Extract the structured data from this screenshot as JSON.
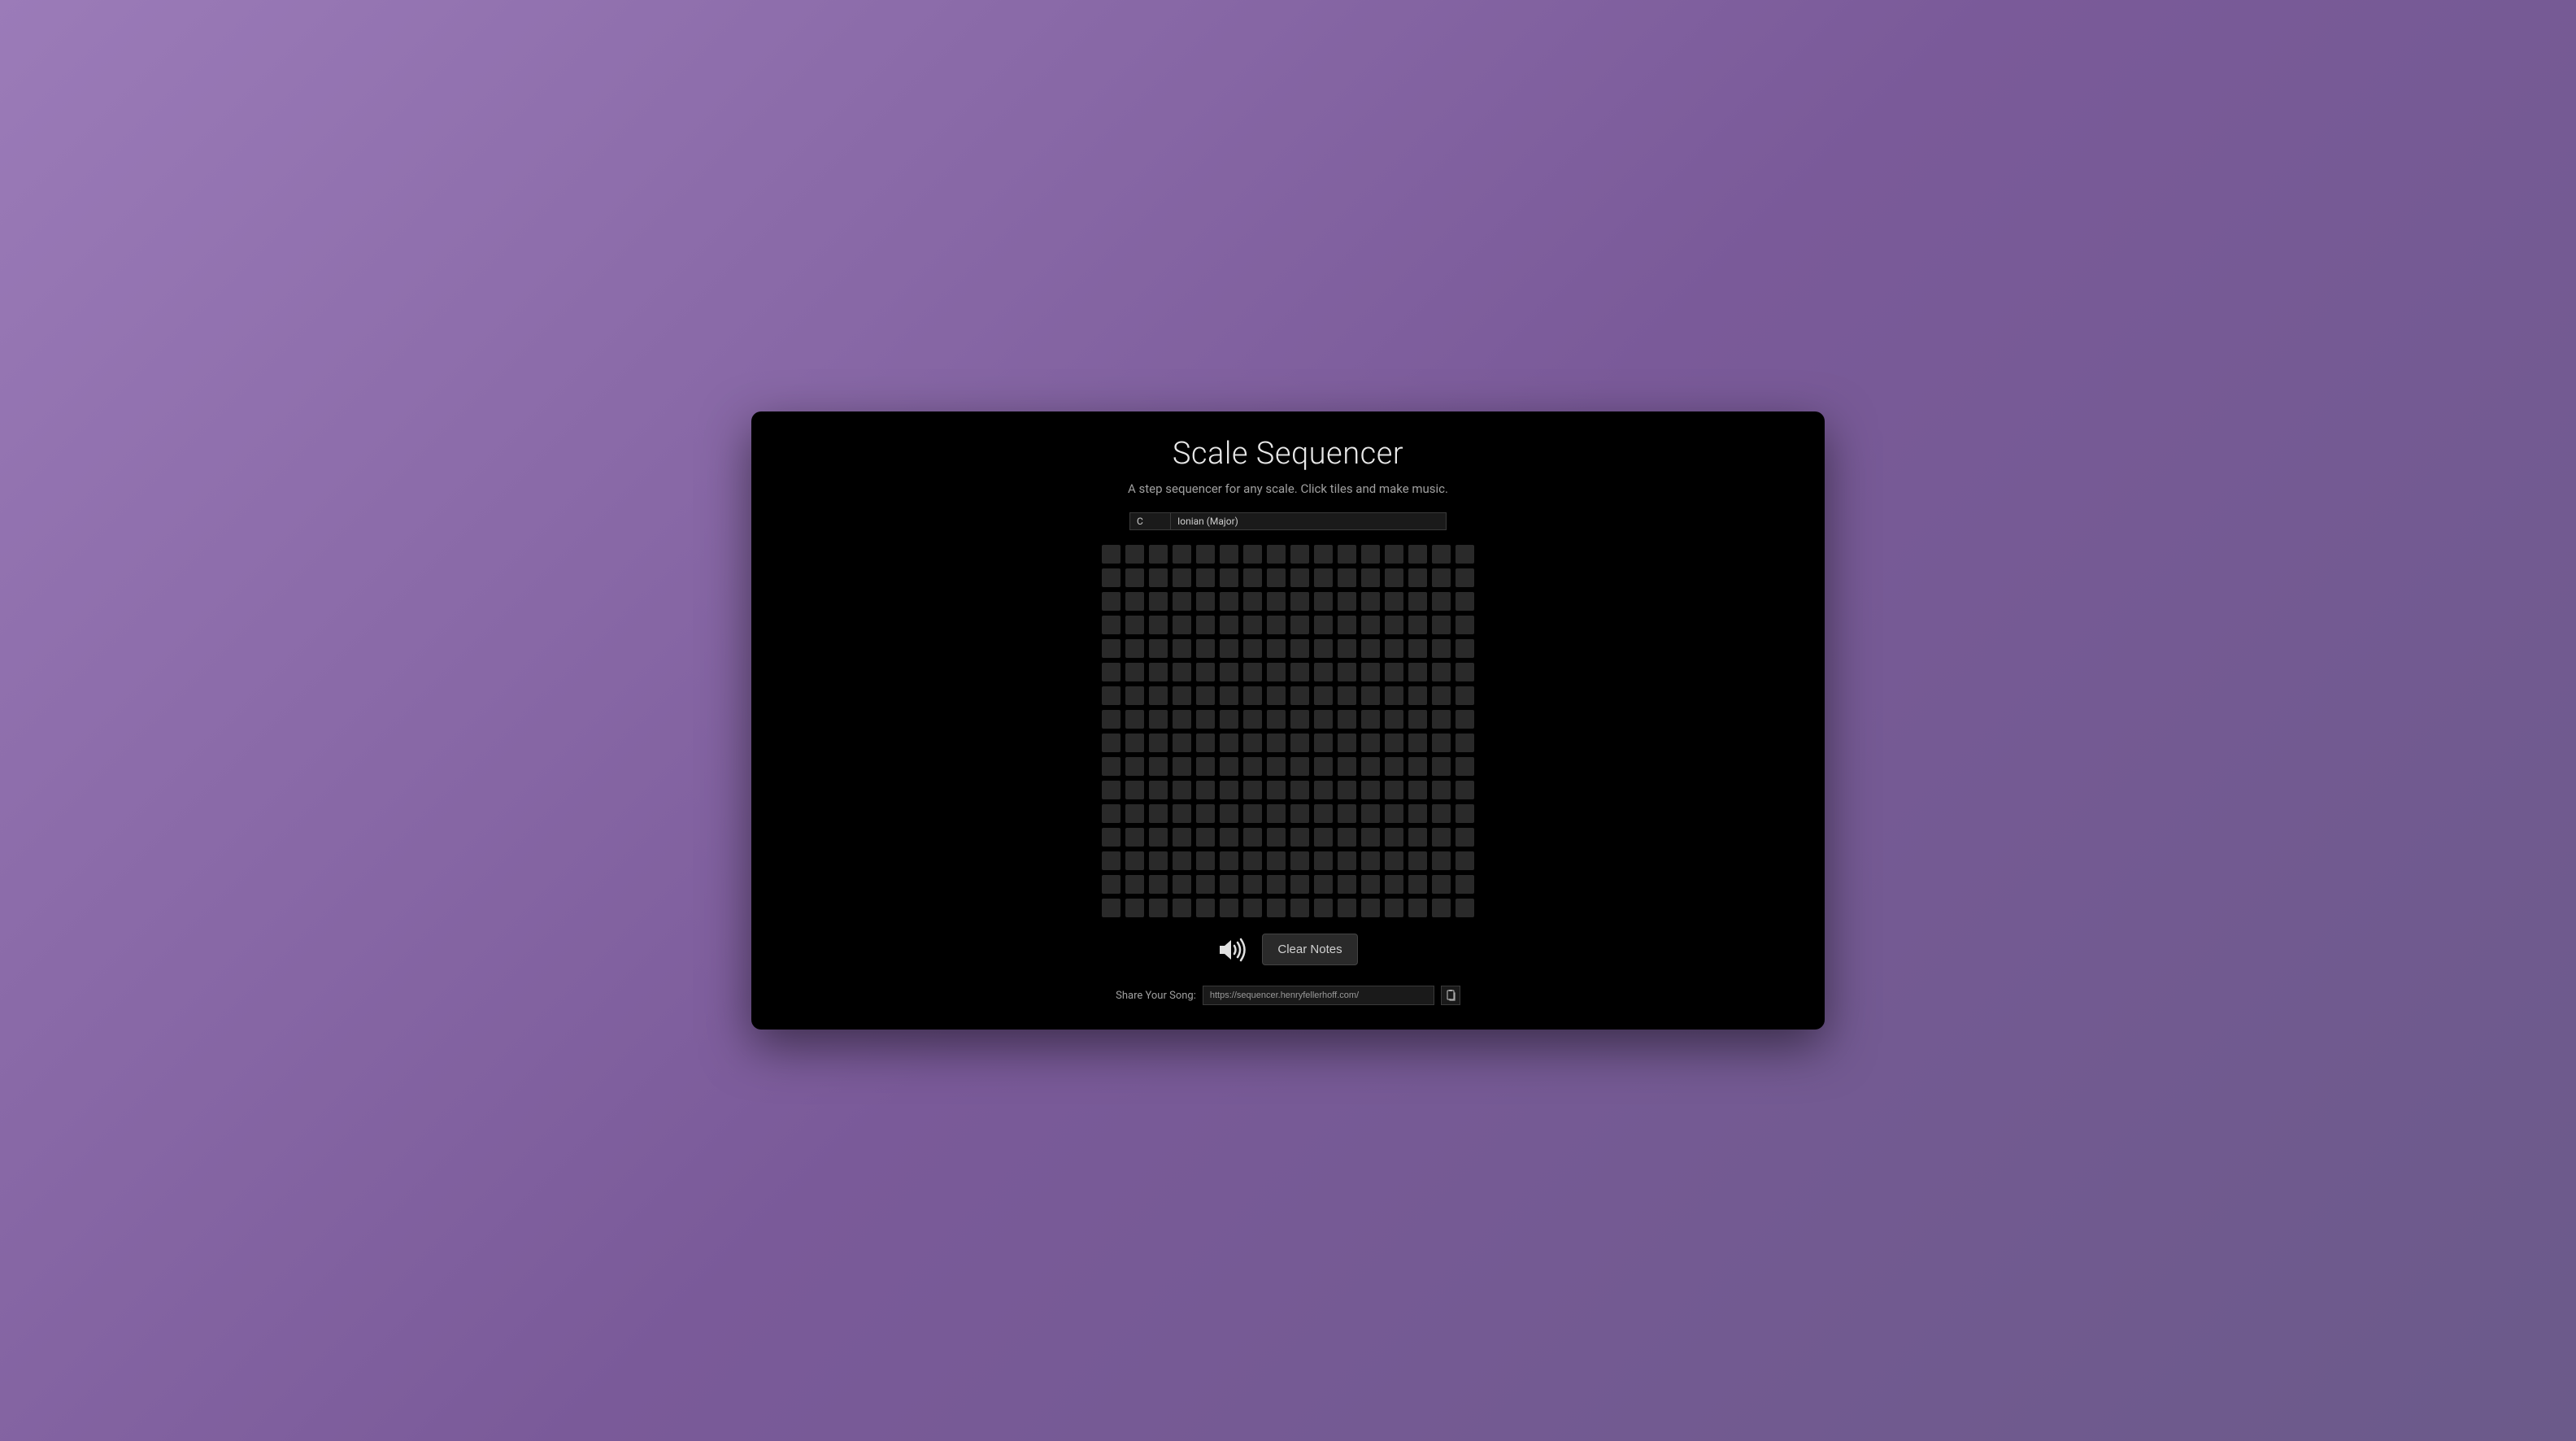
{
  "header": {
    "title": "Scale Sequencer",
    "subtitle": "A step sequencer for any scale. Click tiles and make music."
  },
  "controls": {
    "key_selected": "C",
    "scale_selected": "Ionian (Major)"
  },
  "grid": {
    "rows": 16,
    "cols": 16
  },
  "playback": {
    "clear_label": "Clear Notes"
  },
  "share": {
    "label": "Share Your Song:",
    "url": "https://sequencer.henryfellerhoff.com/"
  }
}
